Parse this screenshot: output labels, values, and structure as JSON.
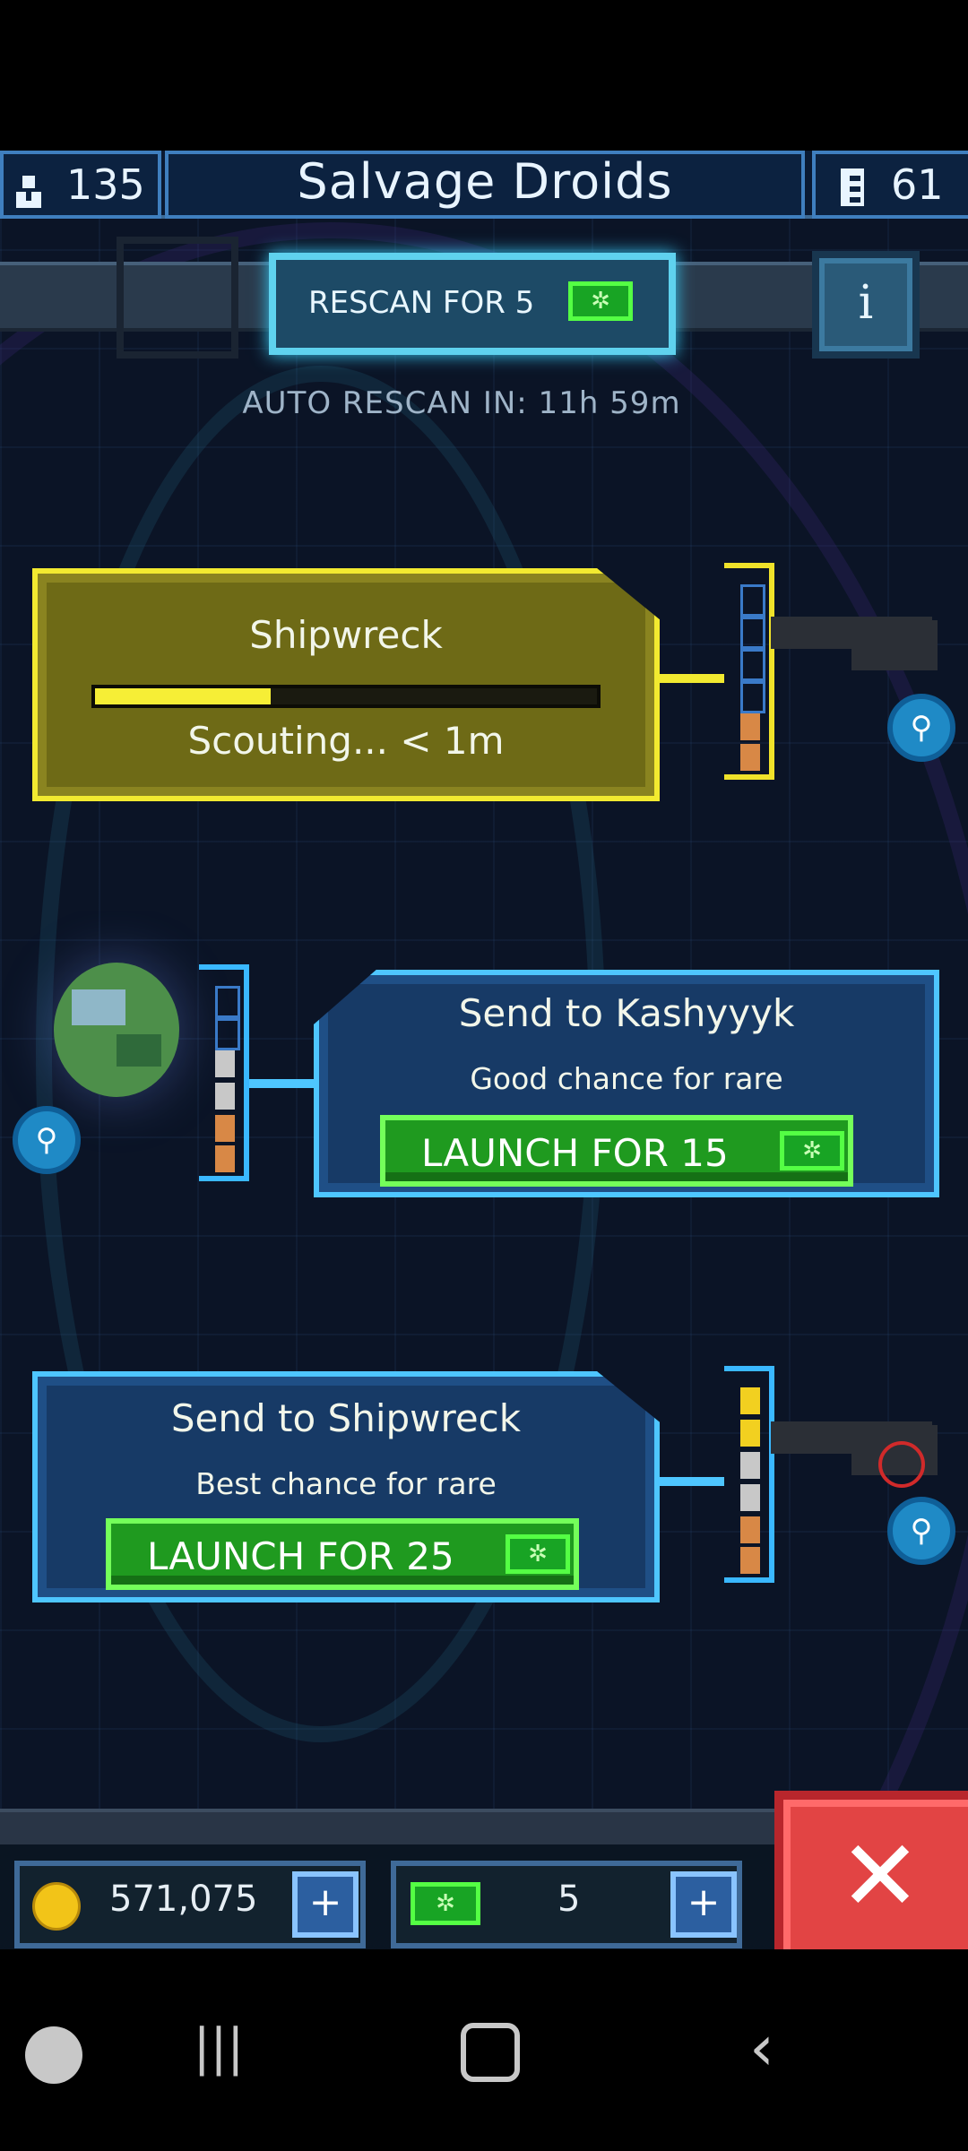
{
  "header": {
    "title": "Salvage Droids",
    "crew_count": "135",
    "parts_count": "61"
  },
  "rescan": {
    "button_label": "RESCAN FOR 5",
    "auto_rescan": "AUTO RESCAN IN: 11h 59m"
  },
  "missions": [
    {
      "title": "Shipwreck",
      "status": "Scouting... < 1m",
      "progress": 0.35
    },
    {
      "title": "Send to Kashyyyk",
      "subtitle": "Good chance for rare",
      "launch_label": "LAUNCH FOR 15"
    },
    {
      "title": "Send to Shipwreck",
      "subtitle": "Best chance for rare",
      "launch_label": "LAUNCH FOR 25"
    }
  ],
  "currency": {
    "credits": "571,075",
    "crystals": "5"
  },
  "icons": {
    "crew": "person-icon",
    "parts": "droid-parts-icon",
    "info": "info-icon",
    "gem": "crystal-icon",
    "magnifier": "magnifier-icon",
    "coin": "coin-icon",
    "plus": "plus-icon",
    "close": "close-icon"
  },
  "colors": {
    "accent_blue": "#4ec6ff",
    "accent_yellow": "#f2ea30",
    "launch_green": "#1f9a1f",
    "close_red": "#e24444"
  }
}
